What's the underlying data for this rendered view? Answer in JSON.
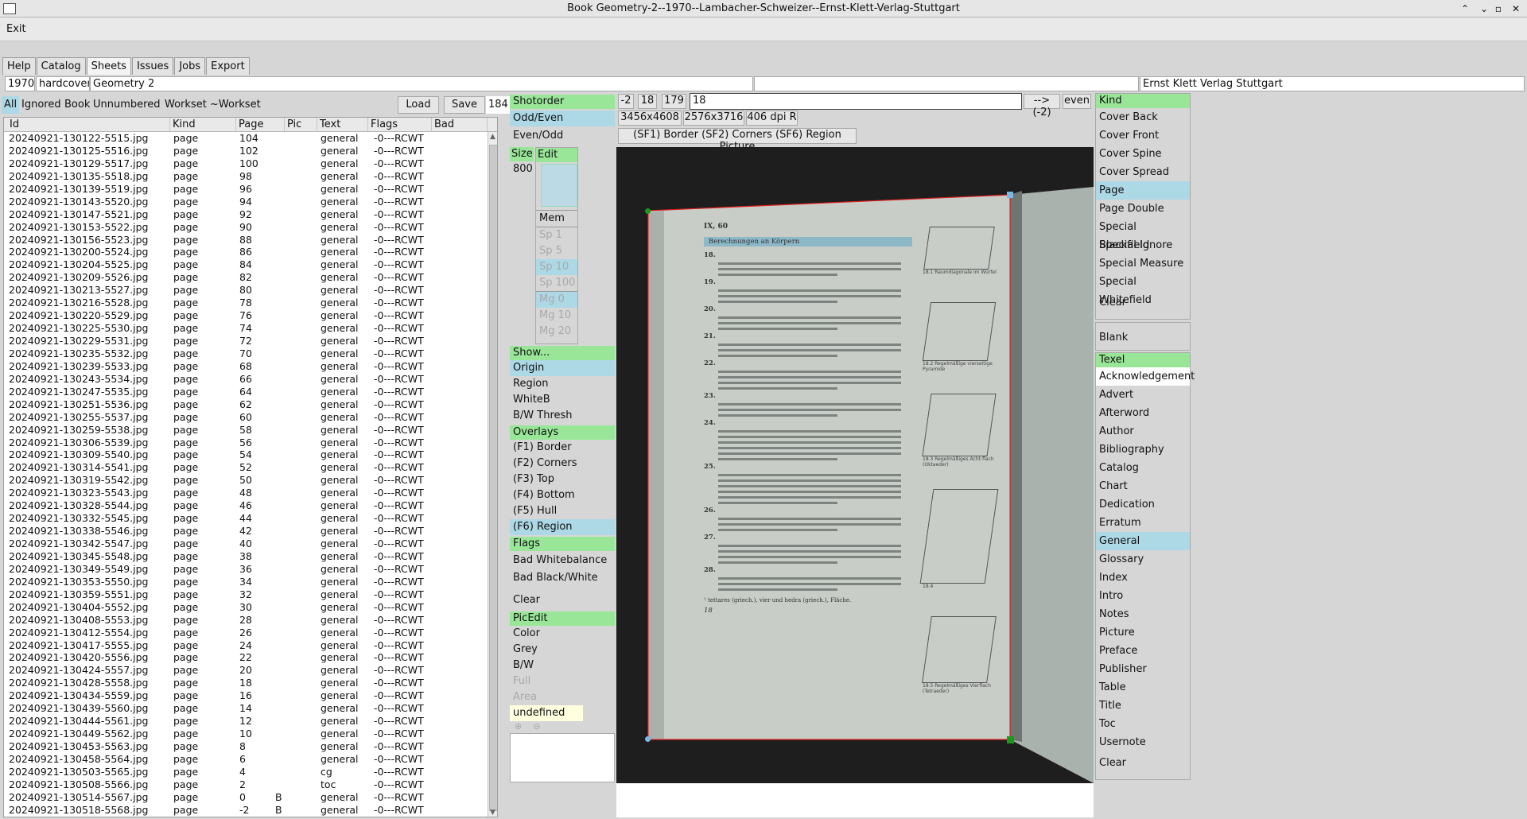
{
  "window": {
    "title": "Book Geometry-2--1970--Lambacher-Schweizer--Ernst-Klett-Verlag-Stuttgart"
  },
  "menu": {
    "exit": "Exit"
  },
  "tabs": [
    "Help",
    "Catalog",
    "Sheets",
    "Issues",
    "Jobs",
    "Export"
  ],
  "book": {
    "year": "1970",
    "binding": "hardcover",
    "title": "Geometry 2",
    "middle": "",
    "publisher": "Ernst Klett Verlag Stuttgart"
  },
  "filters": {
    "all": "All",
    "ignored": "Ignored",
    "book": "Book",
    "unnumbered": "Unnumbered",
    "workset": "Workset",
    "not_workset": "~Workset",
    "load": "Load",
    "save": "Save",
    "count": "184"
  },
  "table": {
    "columns": [
      "Id",
      "Kind",
      "Page",
      "Pic",
      "Text",
      "Flags",
      "Bad"
    ],
    "rows": [
      [
        "20240921-130122-5515.jpg",
        "page",
        "104",
        "",
        "general",
        "-0---RCWT",
        ""
      ],
      [
        "20240921-130125-5516.jpg",
        "page",
        "102",
        "",
        "general",
        "-0---RCWT",
        ""
      ],
      [
        "20240921-130129-5517.jpg",
        "page",
        "100",
        "",
        "general",
        "-0---RCWT",
        ""
      ],
      [
        "20240921-130135-5518.jpg",
        "page",
        "98",
        "",
        "general",
        "-0---RCWT",
        ""
      ],
      [
        "20240921-130139-5519.jpg",
        "page",
        "96",
        "",
        "general",
        "-0---RCWT",
        ""
      ],
      [
        "20240921-130143-5520.jpg",
        "page",
        "94",
        "",
        "general",
        "-0---RCWT",
        ""
      ],
      [
        "20240921-130147-5521.jpg",
        "page",
        "92",
        "",
        "general",
        "-0---RCWT",
        ""
      ],
      [
        "20240921-130153-5522.jpg",
        "page",
        "90",
        "",
        "general",
        "-0---RCWT",
        ""
      ],
      [
        "20240921-130156-5523.jpg",
        "page",
        "88",
        "",
        "general",
        "-0---RCWT",
        ""
      ],
      [
        "20240921-130200-5524.jpg",
        "page",
        "86",
        "",
        "general",
        "-0---RCWT",
        ""
      ],
      [
        "20240921-130204-5525.jpg",
        "page",
        "84",
        "",
        "general",
        "-0---RCWT",
        ""
      ],
      [
        "20240921-130209-5526.jpg",
        "page",
        "82",
        "",
        "general",
        "-0---RCWT",
        ""
      ],
      [
        "20240921-130213-5527.jpg",
        "page",
        "80",
        "",
        "general",
        "-0---RCWT",
        ""
      ],
      [
        "20240921-130216-5528.jpg",
        "page",
        "78",
        "",
        "general",
        "-0---RCWT",
        ""
      ],
      [
        "20240921-130220-5529.jpg",
        "page",
        "76",
        "",
        "general",
        "-0---RCWT",
        ""
      ],
      [
        "20240921-130225-5530.jpg",
        "page",
        "74",
        "",
        "general",
        "-0---RCWT",
        ""
      ],
      [
        "20240921-130229-5531.jpg",
        "page",
        "72",
        "",
        "general",
        "-0---RCWT",
        ""
      ],
      [
        "20240921-130235-5532.jpg",
        "page",
        "70",
        "",
        "general",
        "-0---RCWT",
        ""
      ],
      [
        "20240921-130239-5533.jpg",
        "page",
        "68",
        "",
        "general",
        "-0---RCWT",
        ""
      ],
      [
        "20240921-130243-5534.jpg",
        "page",
        "66",
        "",
        "general",
        "-0---RCWT",
        ""
      ],
      [
        "20240921-130247-5535.jpg",
        "page",
        "64",
        "",
        "general",
        "-0---RCWT",
        ""
      ],
      [
        "20240921-130251-5536.jpg",
        "page",
        "62",
        "",
        "general",
        "-0---RCWT",
        ""
      ],
      [
        "20240921-130255-5537.jpg",
        "page",
        "60",
        "",
        "general",
        "-0---RCWT",
        ""
      ],
      [
        "20240921-130259-5538.jpg",
        "page",
        "58",
        "",
        "general",
        "-0---RCWT",
        ""
      ],
      [
        "20240921-130306-5539.jpg",
        "page",
        "56",
        "",
        "general",
        "-0---RCWT",
        ""
      ],
      [
        "20240921-130309-5540.jpg",
        "page",
        "54",
        "",
        "general",
        "-0---RCWT",
        ""
      ],
      [
        "20240921-130314-5541.jpg",
        "page",
        "52",
        "",
        "general",
        "-0---RCWT",
        ""
      ],
      [
        "20240921-130319-5542.jpg",
        "page",
        "50",
        "",
        "general",
        "-0---RCWT",
        ""
      ],
      [
        "20240921-130323-5543.jpg",
        "page",
        "48",
        "",
        "general",
        "-0---RCWT",
        ""
      ],
      [
        "20240921-130328-5544.jpg",
        "page",
        "46",
        "",
        "general",
        "-0---RCWT",
        ""
      ],
      [
        "20240921-130332-5545.jpg",
        "page",
        "44",
        "",
        "general",
        "-0---RCWT",
        ""
      ],
      [
        "20240921-130338-5546.jpg",
        "page",
        "42",
        "",
        "general",
        "-0---RCWT",
        ""
      ],
      [
        "20240921-130342-5547.jpg",
        "page",
        "40",
        "",
        "general",
        "-0---RCWT",
        ""
      ],
      [
        "20240921-130345-5548.jpg",
        "page",
        "38",
        "",
        "general",
        "-0---RCWT",
        ""
      ],
      [
        "20240921-130349-5549.jpg",
        "page",
        "36",
        "",
        "general",
        "-0---RCWT",
        ""
      ],
      [
        "20240921-130353-5550.jpg",
        "page",
        "34",
        "",
        "general",
        "-0---RCWT",
        ""
      ],
      [
        "20240921-130359-5551.jpg",
        "page",
        "32",
        "",
        "general",
        "-0---RCWT",
        ""
      ],
      [
        "20240921-130404-5552.jpg",
        "page",
        "30",
        "",
        "general",
        "-0---RCWT",
        ""
      ],
      [
        "20240921-130408-5553.jpg",
        "page",
        "28",
        "",
        "general",
        "-0---RCWT",
        ""
      ],
      [
        "20240921-130412-5554.jpg",
        "page",
        "26",
        "",
        "general",
        "-0---RCWT",
        ""
      ],
      [
        "20240921-130417-5555.jpg",
        "page",
        "24",
        "",
        "general",
        "-0---RCWT",
        ""
      ],
      [
        "20240921-130420-5556.jpg",
        "page",
        "22",
        "",
        "general",
        "-0---RCWT",
        ""
      ],
      [
        "20240921-130424-5557.jpg",
        "page",
        "20",
        "",
        "general",
        "-0---RCWT",
        ""
      ],
      [
        "20240921-130428-5558.jpg",
        "page",
        "18",
        "",
        "general",
        "-0---RCWT",
        ""
      ],
      [
        "20240921-130434-5559.jpg",
        "page",
        "16",
        "",
        "general",
        "-0---RCWT",
        ""
      ],
      [
        "20240921-130439-5560.jpg",
        "page",
        "14",
        "",
        "general",
        "-0---RCWT",
        ""
      ],
      [
        "20240921-130444-5561.jpg",
        "page",
        "12",
        "",
        "general",
        "-0---RCWT",
        ""
      ],
      [
        "20240921-130449-5562.jpg",
        "page",
        "10",
        "",
        "general",
        "-0---RCWT",
        ""
      ],
      [
        "20240921-130453-5563.jpg",
        "page",
        "8",
        "",
        "general",
        "-0---RCWT",
        ""
      ],
      [
        "20240921-130458-5564.jpg",
        "page",
        "6",
        "",
        "general",
        "-0---RCWT",
        ""
      ],
      [
        "20240921-130503-5565.jpg",
        "page",
        "4",
        "",
        "cg",
        "-0---RCWT",
        ""
      ],
      [
        "20240921-130508-5566.jpg",
        "page",
        "2",
        "",
        "toc",
        "-0---RCWT",
        ""
      ],
      [
        "20240921-130514-5567.jpg",
        "page",
        "0",
        "B",
        "general",
        "-0---RCWT",
        ""
      ],
      [
        "20240921-130518-5568.jpg",
        "page",
        "-2",
        "B",
        "general",
        "-0---RCWT",
        ""
      ]
    ]
  },
  "left_panel": {
    "shotorder": "Shotorder",
    "odd_even": "Odd/Even",
    "even_odd": "Even/Odd",
    "size_label": "Size",
    "size_value": "800",
    "edit_label": "Edit",
    "mem": "Mem",
    "sp1": "Sp   1",
    "sp5": "Sp   5",
    "sp10": "Sp  10",
    "sp100": "Sp 100",
    "mg0": "Mg  0",
    "mg10": "Mg 10",
    "mg20": "Mg 20",
    "show_header": "Show...",
    "show_items": [
      "Origin",
      "Region",
      "WhiteB",
      "B/W Thresh"
    ],
    "overlays_header": "Overlays",
    "overlay_items": [
      "(F1) Border",
      "(F2) Corners",
      "(F3) Top",
      "(F4) Bottom",
      "(F5) Hull",
      "(F6) Region"
    ],
    "flags_header": "Flags",
    "flag_items": [
      "Bad Whitebalance",
      "Bad Black/White"
    ],
    "flags_clear": "Clear",
    "picedit_header": "PicEdit",
    "picedit_items": [
      "Color",
      "Grey",
      "B/W"
    ],
    "picedit_disabled": [
      "Full",
      "Area"
    ],
    "picedit_value": "undefined"
  },
  "viewer": {
    "nav": [
      "-2",
      "18",
      "179"
    ],
    "page_input": "18",
    "arrow": "--> (-2)",
    "parity": "even",
    "dims": [
      "3456x4608",
      "2576x3716",
      "406 dpi R"
    ],
    "shortcuts": "(SF1) Border  (SF2) Corners  (SF6) Region  Picture"
  },
  "kind": {
    "header": "Kind",
    "items": [
      "Cover Back",
      "Cover Front",
      "Cover Spine",
      "Cover Spread",
      "Page",
      "Page Double",
      "Special Blackfield",
      "Special Ignore",
      "Special Measure",
      "Special Whitefield"
    ],
    "selected": "Page",
    "clear": "Clear",
    "blank": "Blank"
  },
  "texel": {
    "header": "Texel",
    "items": [
      "Acknowledgement",
      "Advert",
      "Afterword",
      "Author",
      "Bibliography",
      "Catalog",
      "Chart",
      "Dedication",
      "Erratum",
      "General",
      "Glossary",
      "Index",
      "Intro",
      "Notes",
      "Picture",
      "Preface",
      "Publisher",
      "Table",
      "Title",
      "Toc",
      "Usernote"
    ],
    "selected": "General",
    "clear": "Clear"
  },
  "page_image": {
    "section_no": "IX, 60",
    "section_title": "Berechnungen an Körpern",
    "page_number": "18",
    "exercises": [
      "18.",
      "19.",
      "20.",
      "21.",
      "22.",
      "23.",
      "24.",
      "25.",
      "26.",
      "27.",
      "28."
    ],
    "captions": [
      "18.1  Raumdiagonale im Würfel",
      "18.2  Regelmäßige vierseitige Pyramide",
      "18.3  Regelmäßiges Acht-flach (Oktaeder)",
      "18.4",
      "18.5  Regelmäßiges Vierflach (Tetraeder)"
    ],
    "footnote": "¹ tettares (griech.), vier und hedra (griech.), Fläche."
  }
}
